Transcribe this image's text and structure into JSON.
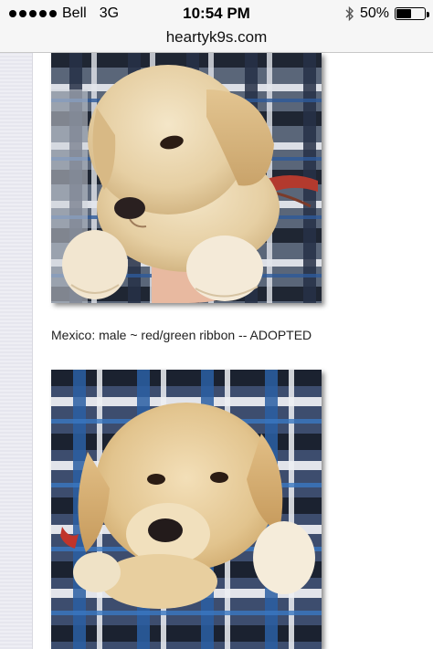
{
  "status_bar": {
    "signal_dots": 5,
    "carrier": "Bell",
    "network": "3G",
    "time": "10:54 PM",
    "battery_percent": "50%",
    "battery_level": 0.5
  },
  "browser": {
    "url": "heartyk9s.com"
  },
  "content": {
    "caption": "Mexico: male ~ red/green ribbon -- ADOPTED"
  },
  "colors": {
    "puppy_fur": "#e9d3ac",
    "plaid_blue": "#2a4f86",
    "plaid_dark": "#1e2430",
    "ribbon": "#c0342a"
  }
}
